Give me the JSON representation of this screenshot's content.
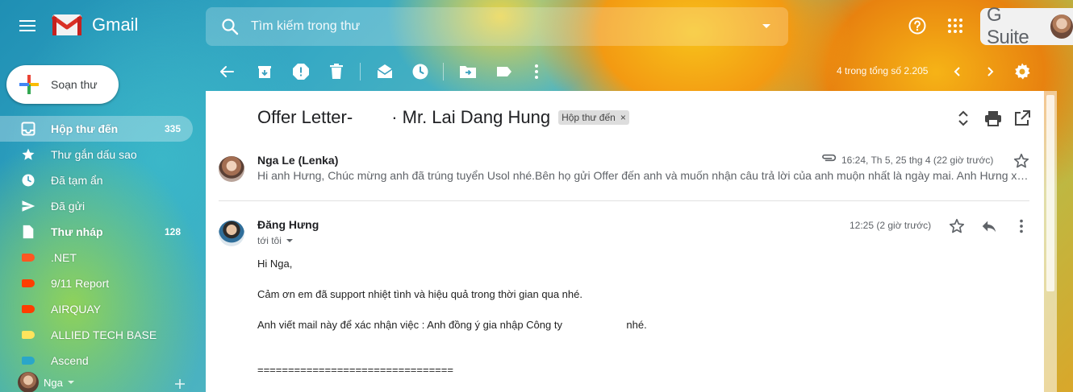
{
  "app": {
    "name": "Gmail"
  },
  "search": {
    "placeholder": "Tìm kiếm trong thư"
  },
  "header": {
    "gsuite_label": "G Suite"
  },
  "sidebar": {
    "compose_label": "Soạn thư",
    "items": [
      {
        "label": "Hộp thư đến",
        "count": "335",
        "bold": true,
        "icon": "inbox-icon"
      },
      {
        "label": "Thư gắn dấu sao",
        "count": "",
        "bold": false,
        "icon": "star-icon"
      },
      {
        "label": "Đã tạm ẩn",
        "count": "",
        "bold": false,
        "icon": "clock-icon"
      },
      {
        "label": "Đã gửi",
        "count": "",
        "bold": false,
        "icon": "send-icon"
      },
      {
        "label": "Thư nháp",
        "count": "128",
        "bold": true,
        "icon": "draft-icon"
      },
      {
        "label": ".NET",
        "count": "",
        "bold": false,
        "icon": "label-icon",
        "color": "#ff5722"
      },
      {
        "label": "9/11 Report",
        "count": "",
        "bold": false,
        "icon": "label-icon",
        "color": "#ff3d00"
      },
      {
        "label": "AIRQUAY",
        "count": "",
        "bold": false,
        "icon": "label-icon",
        "color": "#ff3d00"
      },
      {
        "label": "ALLIED TECH BASE",
        "count": "",
        "bold": false,
        "icon": "label-icon",
        "color": "#ffe45c"
      },
      {
        "label": "Ascend",
        "count": "",
        "bold": false,
        "icon": "label-icon",
        "color": "#2aa6c9"
      }
    ],
    "user_name": "Nga"
  },
  "toolbar": {
    "pager_text": "4 trong tổng số 2.205"
  },
  "email": {
    "subject_part1": "Offer Letter-",
    "subject_part2": "· Mr. Lai Dang Hung",
    "label_chip": "Hộp thư đến",
    "label_chip_close": "×",
    "messages": [
      {
        "sender": "Nga Le (Lenka)",
        "time": "16:24, Th 5, 25 thg 4 (22 giờ trước)",
        "snippet": "Hi anh Hưng, Chúc mừng anh đã trúng tuyển Usol nhé.Bên họ gửi Offer đến anh và muốn nhận câu trả lời của anh muộn nhất là ngày mai. Anh Hưng xem và phản hồi giúp em nhé"
      },
      {
        "sender": "Đăng Hưng",
        "time": "12:25 (2 giờ trước)",
        "to": "tới tôi",
        "body": [
          "Hi Nga,",
          "Cảm ơn em đã support nhiệt tình và hiệu quả trong thời gian qua nhé.",
          "Anh viết mail này để xác nhận việc : Anh đồng ý gia nhập Công ty                      nhé.",
          "================================"
        ]
      }
    ]
  },
  "colors": {
    "compose_bg": "#ffffff",
    "panel_bg": "#ffffff",
    "chip_bg": "#dddddd",
    "text_primary": "#202124",
    "text_secondary": "#5f6368"
  }
}
